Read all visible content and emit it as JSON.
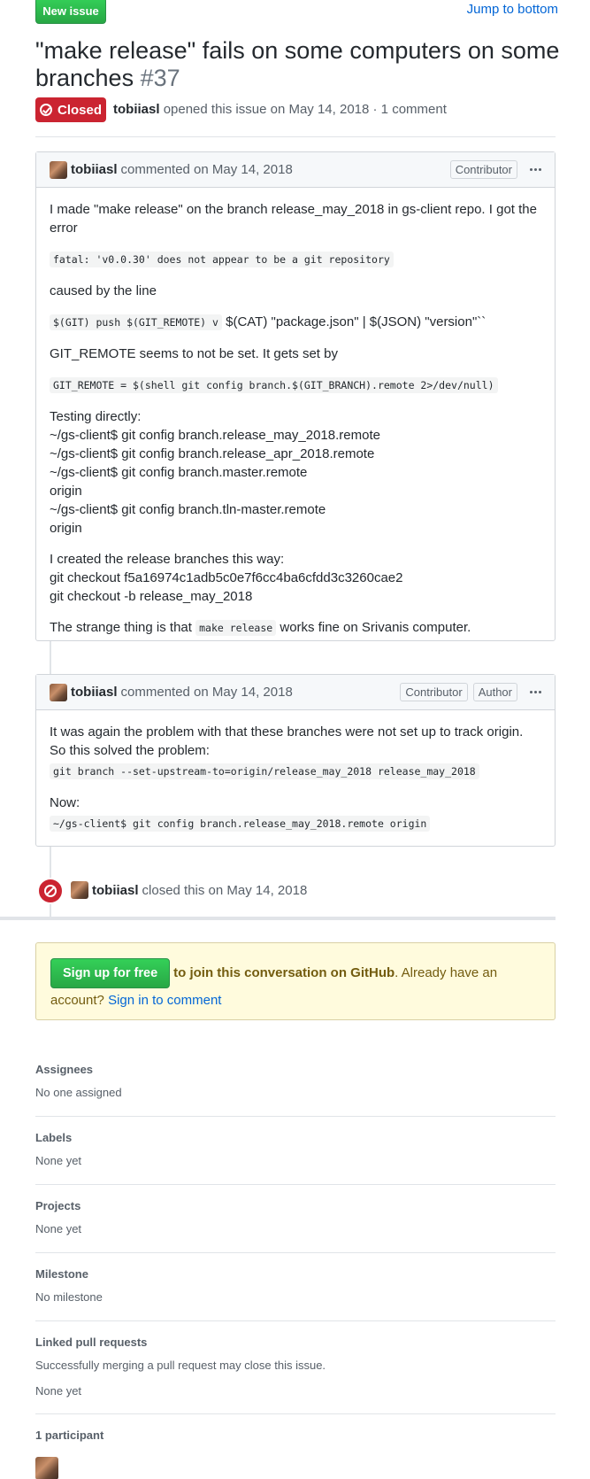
{
  "header": {
    "new_issue_label": "New issue",
    "jump_label": "Jump to bottom"
  },
  "issue": {
    "title": "\"make release\" fails on some computers on some branches",
    "number": "#37",
    "state": "Closed",
    "author": "tobiiasl",
    "opened_text": "opened this issue on May 14, 2018 · 1 comment"
  },
  "comments": [
    {
      "author": "tobiiasl",
      "date_text": "commented on May 14, 2018",
      "badges": [
        "Contributor"
      ],
      "body": {
        "p1": "I made \"make release\" on the branch release_may_2018 in gs-client repo. I got the error",
        "code1": "fatal: 'v0.0.30' does not appear to be a git repository",
        "p2": "caused by the line",
        "code2": "$(GIT) push $(GIT_REMOTE) v",
        "p3_tail": " $(CAT) \"package.json\" | $(JSON) \"version\"``",
        "p4": "GIT_REMOTE seems to not be set. It gets set by",
        "code3": "GIT_REMOTE = $(shell git config branch.$(GIT_BRANCH).remote 2>/dev/null)",
        "testing": [
          "Testing directly:",
          "~/gs-client$ git config branch.release_may_2018.remote",
          "~/gs-client$ git config branch.release_apr_2018.remote",
          "~/gs-client$ git config branch.master.remote",
          "origin",
          "~/gs-client$ git config branch.tln-master.remote",
          "origin"
        ],
        "created": [
          "I created the release branches this way:",
          "git checkout f5a16974c1adb5c0e7f6cc4ba6cfdd3c3260cae2",
          "git checkout -b release_may_2018"
        ],
        "strange_pre": "The strange thing is that ",
        "strange_code": "make release",
        "strange_post": " works fine on Srivanis computer."
      }
    },
    {
      "author": "tobiiasl",
      "date_text": "commented on May 14, 2018",
      "badges": [
        "Contributor",
        "Author"
      ],
      "body": {
        "p1": "It was again the problem with that these branches were not set up to track origin. So this solved the problem:",
        "code1": "git branch --set-upstream-to=origin/release_may_2018 release_may_2018",
        "p2": "Now:",
        "code2": "~/gs-client$ git config branch.release_may_2018.remote origin"
      }
    }
  ],
  "closed_event": {
    "author": "tobiiasl",
    "text": "closed this on May 14, 2018"
  },
  "signup": {
    "button": "Sign up for free",
    "join_text": "to join this conversation on GitHub",
    "already": ". Already have an account?",
    "signin": "Sign in to comment"
  },
  "sidebar": {
    "assignees": {
      "heading": "Assignees",
      "value": "No one assigned"
    },
    "labels": {
      "heading": "Labels",
      "value": "None yet"
    },
    "projects": {
      "heading": "Projects",
      "value": "None yet"
    },
    "milestone": {
      "heading": "Milestone",
      "value": "No milestone"
    },
    "linked_prs": {
      "heading": "Linked pull requests",
      "note": "Successfully merging a pull request may close this issue.",
      "value": "None yet"
    },
    "participants": {
      "heading": "1 participant"
    }
  }
}
